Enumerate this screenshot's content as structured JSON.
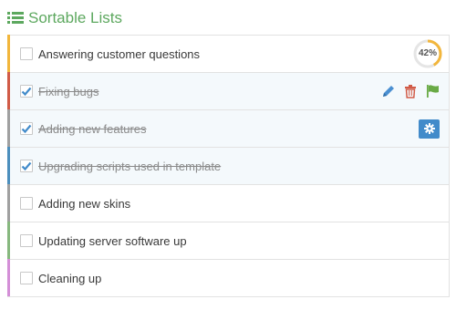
{
  "header": {
    "title": "Sortable Lists",
    "icon": "list-icon",
    "color": "#5da85f"
  },
  "tasks": [
    {
      "label": "Answering customer questions",
      "checked": false,
      "color": "#f2b63c",
      "progress_label": "42%",
      "progress": 0.42
    },
    {
      "label": "Fixing bugs",
      "checked": true,
      "color": "#d15b47",
      "actions": [
        "pencil-icon",
        "trash-icon",
        "flag-icon"
      ]
    },
    {
      "label": "Adding new features",
      "checked": true,
      "color": "#a0a0a0",
      "actions": [
        "cog-icon"
      ]
    },
    {
      "label": "Upgrading scripts used in template",
      "checked": true,
      "color": "#4c8fbd"
    },
    {
      "label": "Adding new skins",
      "checked": false,
      "color": "#a0a0a0"
    },
    {
      "label": "Updating server software up",
      "checked": false,
      "color": "#87b87f"
    },
    {
      "label": "Cleaning up",
      "checked": false,
      "color": "#d48fd7"
    }
  ],
  "colors": {
    "accent": "#428bca",
    "edit": "#4a8fd1",
    "delete": "#d15b47",
    "flag": "#69aa46",
    "progress": "#f2b63c"
  }
}
